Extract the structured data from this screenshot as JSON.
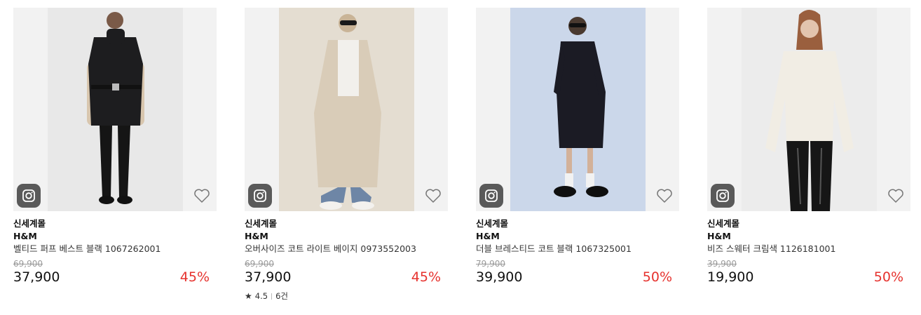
{
  "products": [
    {
      "mall": "신세계몰",
      "brand": "H&M",
      "name": "벨티드 퍼프 베스트 블랙 1067262001",
      "original_price": "69,900",
      "price": "37,900",
      "discount": "45%",
      "icons": {
        "insta": "instagram-icon",
        "heart": "heart-icon"
      }
    },
    {
      "mall": "신세계몰",
      "brand": "H&M",
      "name": "오버사이즈 코트 라이트 베이지 0973552003",
      "original_price": "69,900",
      "price": "37,900",
      "discount": "45%",
      "rating": "4.5",
      "review_count": "6건",
      "icons": {
        "insta": "instagram-icon",
        "heart": "heart-icon"
      }
    },
    {
      "mall": "신세계몰",
      "brand": "H&M",
      "name": "더블 브레스티드 코트 블랙 1067325001",
      "original_price": "79,900",
      "price": "39,900",
      "discount": "50%",
      "icons": {
        "insta": "instagram-icon",
        "heart": "heart-icon"
      }
    },
    {
      "mall": "신세계몰",
      "brand": "H&M",
      "name": "비즈 스웨터 크림색 1126181001",
      "original_price": "39,900",
      "price": "19,900",
      "discount": "50%",
      "icons": {
        "insta": "instagram-icon",
        "heart": "heart-icon"
      }
    }
  ],
  "colors": {
    "discount": "#e6322e",
    "thumb_bg": "#f2f2f2",
    "icon_bg": "#5a5a5a"
  }
}
